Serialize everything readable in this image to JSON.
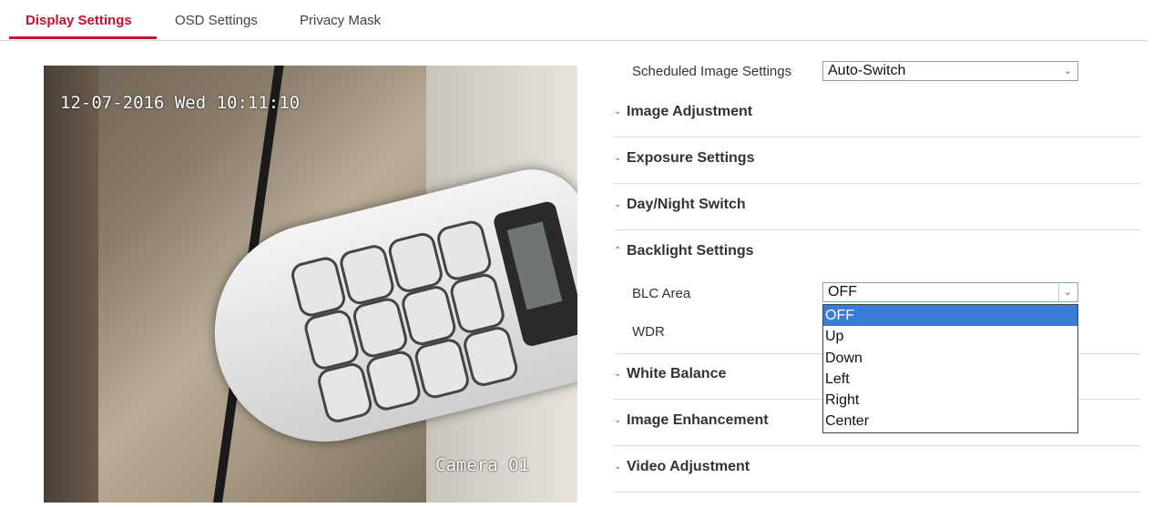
{
  "tabs": [
    {
      "label": "Display Settings",
      "active": true
    },
    {
      "label": "OSD Settings",
      "active": false
    },
    {
      "label": "Privacy Mask",
      "active": false
    }
  ],
  "video": {
    "osd_datetime": "12-07-2016 Wed 10:11:10",
    "osd_camera": "Camera 01"
  },
  "scheduled": {
    "label": "Scheduled Image Settings",
    "value": "Auto-Switch"
  },
  "sections": [
    {
      "label": "Image Adjustment",
      "expanded": false
    },
    {
      "label": "Exposure Settings",
      "expanded": false
    },
    {
      "label": "Day/Night Switch",
      "expanded": false
    },
    {
      "label": "Backlight Settings",
      "expanded": true
    },
    {
      "label": "White Balance",
      "expanded": false
    },
    {
      "label": "Image Enhancement",
      "expanded": false
    },
    {
      "label": "Video Adjustment",
      "expanded": false
    }
  ],
  "backlight": {
    "blc_label": "BLC Area",
    "blc_value": "OFF",
    "wdr_label": "WDR",
    "blc_options": [
      "OFF",
      "Up",
      "Down",
      "Left",
      "Right",
      "Center"
    ],
    "selected_option": "OFF"
  },
  "icons": {
    "collapsed": "chevron-down-icon",
    "expanded": "chevron-up-icon",
    "select": "chevron-down-icon"
  },
  "colors": {
    "accent": "#c8102e",
    "selection": "#3a7bd5"
  }
}
